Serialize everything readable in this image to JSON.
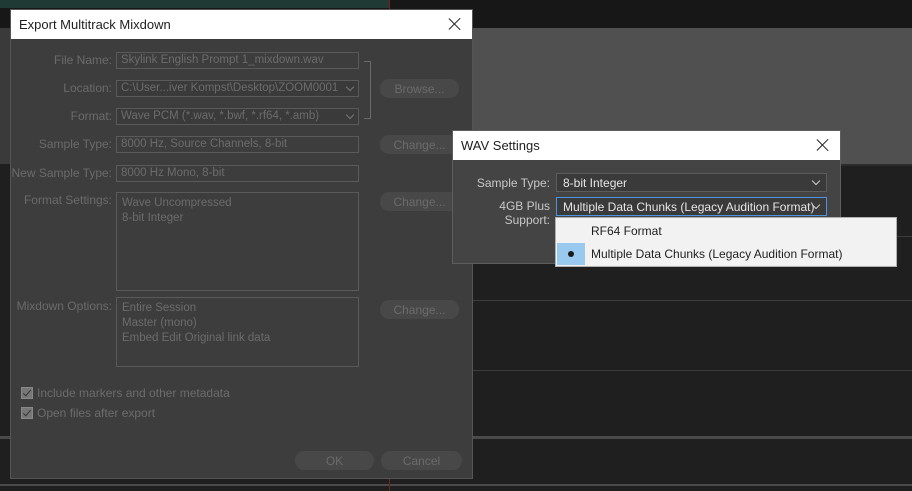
{
  "export_dialog": {
    "title": "Export Multitrack Mixdown",
    "file_name_label": "File Name:",
    "file_name_value": "Skylink English Prompt 1_mixdown.wav",
    "location_label": "Location:",
    "location_value": "C:\\User...iver Kompst\\Desktop\\ZOOM0001",
    "browse_label": "Browse...",
    "format_label": "Format:",
    "format_value": "Wave PCM (*.wav, *.bwf, *.rf64, *.amb)",
    "sample_type_label": "Sample Type:",
    "sample_type_value": "8000 Hz, Source Channels, 8-bit",
    "change_label": "Change...",
    "new_sample_type_label": "New Sample Type:",
    "new_sample_type_value": "8000 Hz Mono, 8-bit",
    "format_settings_label": "Format Settings:",
    "format_settings_lines": [
      "Wave Uncompressed",
      "8-bit Integer"
    ],
    "mixdown_options_label": "Mixdown Options:",
    "mixdown_options_lines": [
      "Entire Session",
      "Master (mono)",
      "Embed Edit Original link data"
    ],
    "include_markers_label": "Include markers and other metadata",
    "open_files_label": "Open files after export",
    "ok_label": "OK",
    "cancel_label": "Cancel"
  },
  "wav_dialog": {
    "title": "WAV Settings",
    "sample_type_label": "Sample Type:",
    "sample_type_value": "8-bit Integer",
    "plus_support_label": "4GB Plus Support:",
    "plus_support_value": "Multiple Data Chunks (Legacy Audition Format)"
  },
  "dropdown": {
    "options": [
      {
        "label": "RF64 Format",
        "selected": false
      },
      {
        "label": "Multiple Data Chunks (Legacy Audition Format)",
        "selected": true
      }
    ]
  },
  "colors": {
    "focus_border": "#4c93e0",
    "selection_marker": "#99c9ef",
    "playhead": "#7a1f1f"
  }
}
